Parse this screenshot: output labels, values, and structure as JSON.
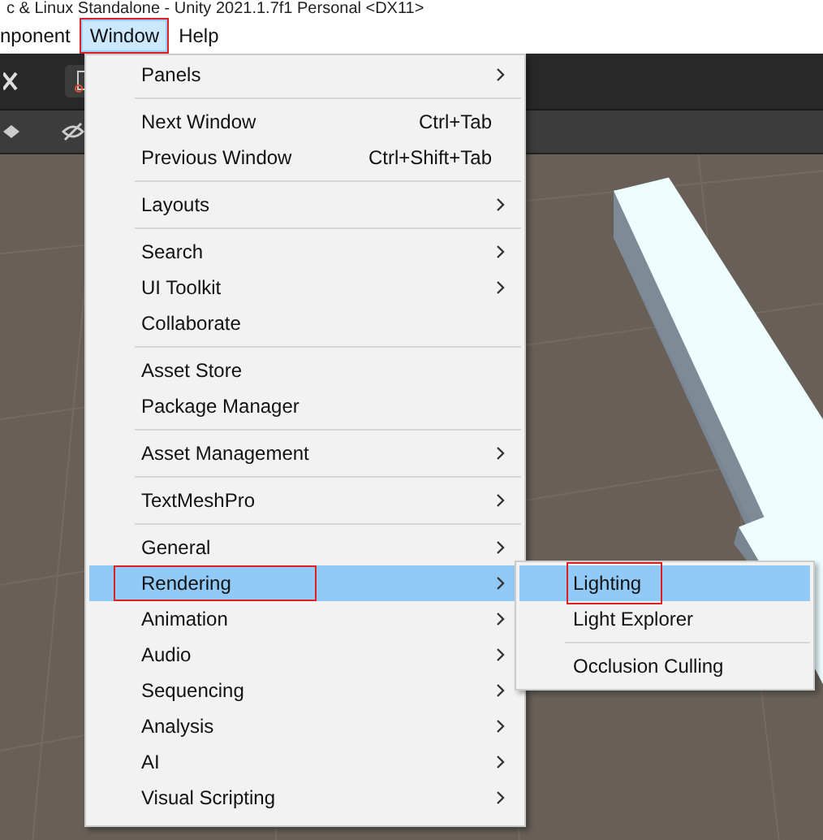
{
  "window": {
    "title": "c & Linux Standalone - Unity 2021.1.7f1 Personal <DX11>"
  },
  "menu_bar": [
    {
      "label": "nponent",
      "selected": false,
      "annotated": false
    },
    {
      "label": "Window",
      "selected": true,
      "annotated": true
    },
    {
      "label": "Help",
      "selected": false,
      "annotated": false
    }
  ],
  "menu": {
    "items": [
      {
        "kind": "item",
        "label": "Panels",
        "submenu": true,
        "selected": false,
        "annotated": false
      },
      {
        "kind": "separator"
      },
      {
        "kind": "item",
        "label": "Next Window",
        "shortcut": "Ctrl+Tab",
        "submenu": false,
        "selected": false,
        "annotated": false
      },
      {
        "kind": "item",
        "label": "Previous Window",
        "shortcut": "Ctrl+Shift+Tab",
        "submenu": false,
        "selected": false,
        "annotated": false
      },
      {
        "kind": "separator"
      },
      {
        "kind": "item",
        "label": "Layouts",
        "submenu": true,
        "selected": false,
        "annotated": false
      },
      {
        "kind": "separator"
      },
      {
        "kind": "item",
        "label": "Search",
        "submenu": true,
        "selected": false,
        "annotated": false
      },
      {
        "kind": "item",
        "label": "UI Toolkit",
        "submenu": true,
        "selected": false,
        "annotated": false
      },
      {
        "kind": "item",
        "label": "Collaborate",
        "submenu": false,
        "selected": false,
        "annotated": false
      },
      {
        "kind": "separator"
      },
      {
        "kind": "item",
        "label": "Asset Store",
        "submenu": false,
        "selected": false,
        "annotated": false
      },
      {
        "kind": "item",
        "label": "Package Manager",
        "submenu": false,
        "selected": false,
        "annotated": false
      },
      {
        "kind": "separator"
      },
      {
        "kind": "item",
        "label": "Asset Management",
        "submenu": true,
        "selected": false,
        "annotated": false
      },
      {
        "kind": "separator"
      },
      {
        "kind": "item",
        "label": "TextMeshPro",
        "submenu": true,
        "selected": false,
        "annotated": false
      },
      {
        "kind": "separator"
      },
      {
        "kind": "item",
        "label": "General",
        "submenu": true,
        "selected": false,
        "annotated": false
      },
      {
        "kind": "item",
        "label": "Rendering",
        "submenu": true,
        "selected": true,
        "annotated": true
      },
      {
        "kind": "item",
        "label": "Animation",
        "submenu": true,
        "selected": false,
        "annotated": false
      },
      {
        "kind": "item",
        "label": "Audio",
        "submenu": true,
        "selected": false,
        "annotated": false
      },
      {
        "kind": "item",
        "label": "Sequencing",
        "submenu": true,
        "selected": false,
        "annotated": false
      },
      {
        "kind": "item",
        "label": "Analysis",
        "submenu": true,
        "selected": false,
        "annotated": false
      },
      {
        "kind": "item",
        "label": "AI",
        "submenu": true,
        "selected": false,
        "annotated": false
      },
      {
        "kind": "item",
        "label": "Visual Scripting",
        "submenu": true,
        "selected": false,
        "annotated": false
      }
    ]
  },
  "submenu": {
    "items": [
      {
        "kind": "item",
        "label": "Lighting",
        "selected": true,
        "annotated": true
      },
      {
        "kind": "item",
        "label": "Light Explorer",
        "selected": false,
        "annotated": false
      },
      {
        "kind": "separator"
      },
      {
        "kind": "item",
        "label": "Occlusion Culling",
        "selected": false,
        "annotated": false
      }
    ]
  }
}
